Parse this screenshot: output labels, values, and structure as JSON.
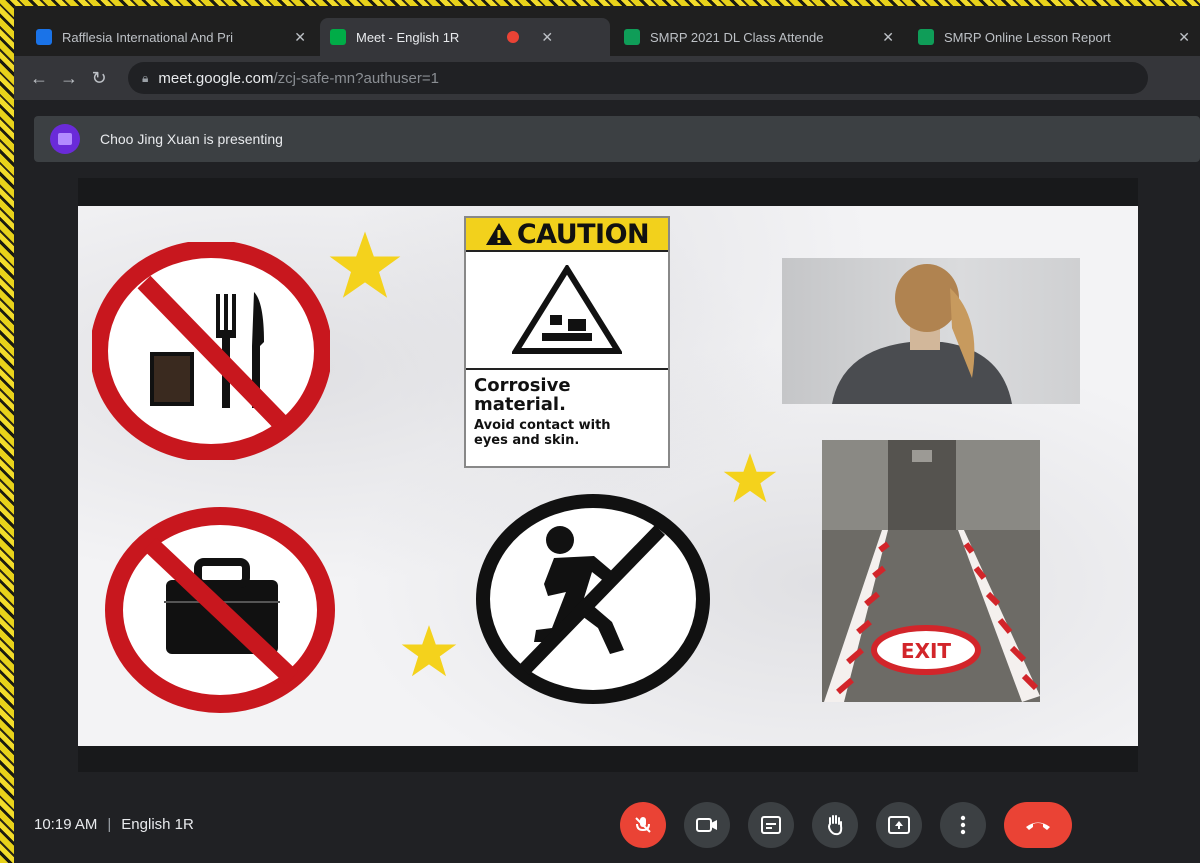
{
  "tabs": [
    {
      "title": "Rafflesia International And Pri",
      "favicon_color": "#1a73e8",
      "active": false
    },
    {
      "title": "Meet - English 1R",
      "favicon_color": "#00ac47",
      "active": true,
      "recording": true
    },
    {
      "title": "SMRP 2021 DL Class Attende",
      "favicon_color": "#0f9d58",
      "active": false
    },
    {
      "title": "SMRP Online Lesson Report",
      "favicon_color": "#0f9d58",
      "active": false
    }
  ],
  "address": {
    "host": "meet.google.com",
    "path": "/zcj-safe-mn?authuser=1"
  },
  "presenting": {
    "text": "Choo Jing Xuan is presenting"
  },
  "slide": {
    "caution": {
      "header": "CAUTION",
      "line1": "Corrosive",
      "line2": "material.",
      "line3": "Avoid contact with",
      "line4": "eyes and skin."
    },
    "exit_label": "EXIT"
  },
  "meeting": {
    "time": "10:19 AM",
    "separator": "|",
    "name": "English 1R"
  },
  "colors": {
    "accent_red": "#ea4335",
    "caution_yellow": "#f2d11c",
    "prohibit_red": "#c8171e"
  }
}
